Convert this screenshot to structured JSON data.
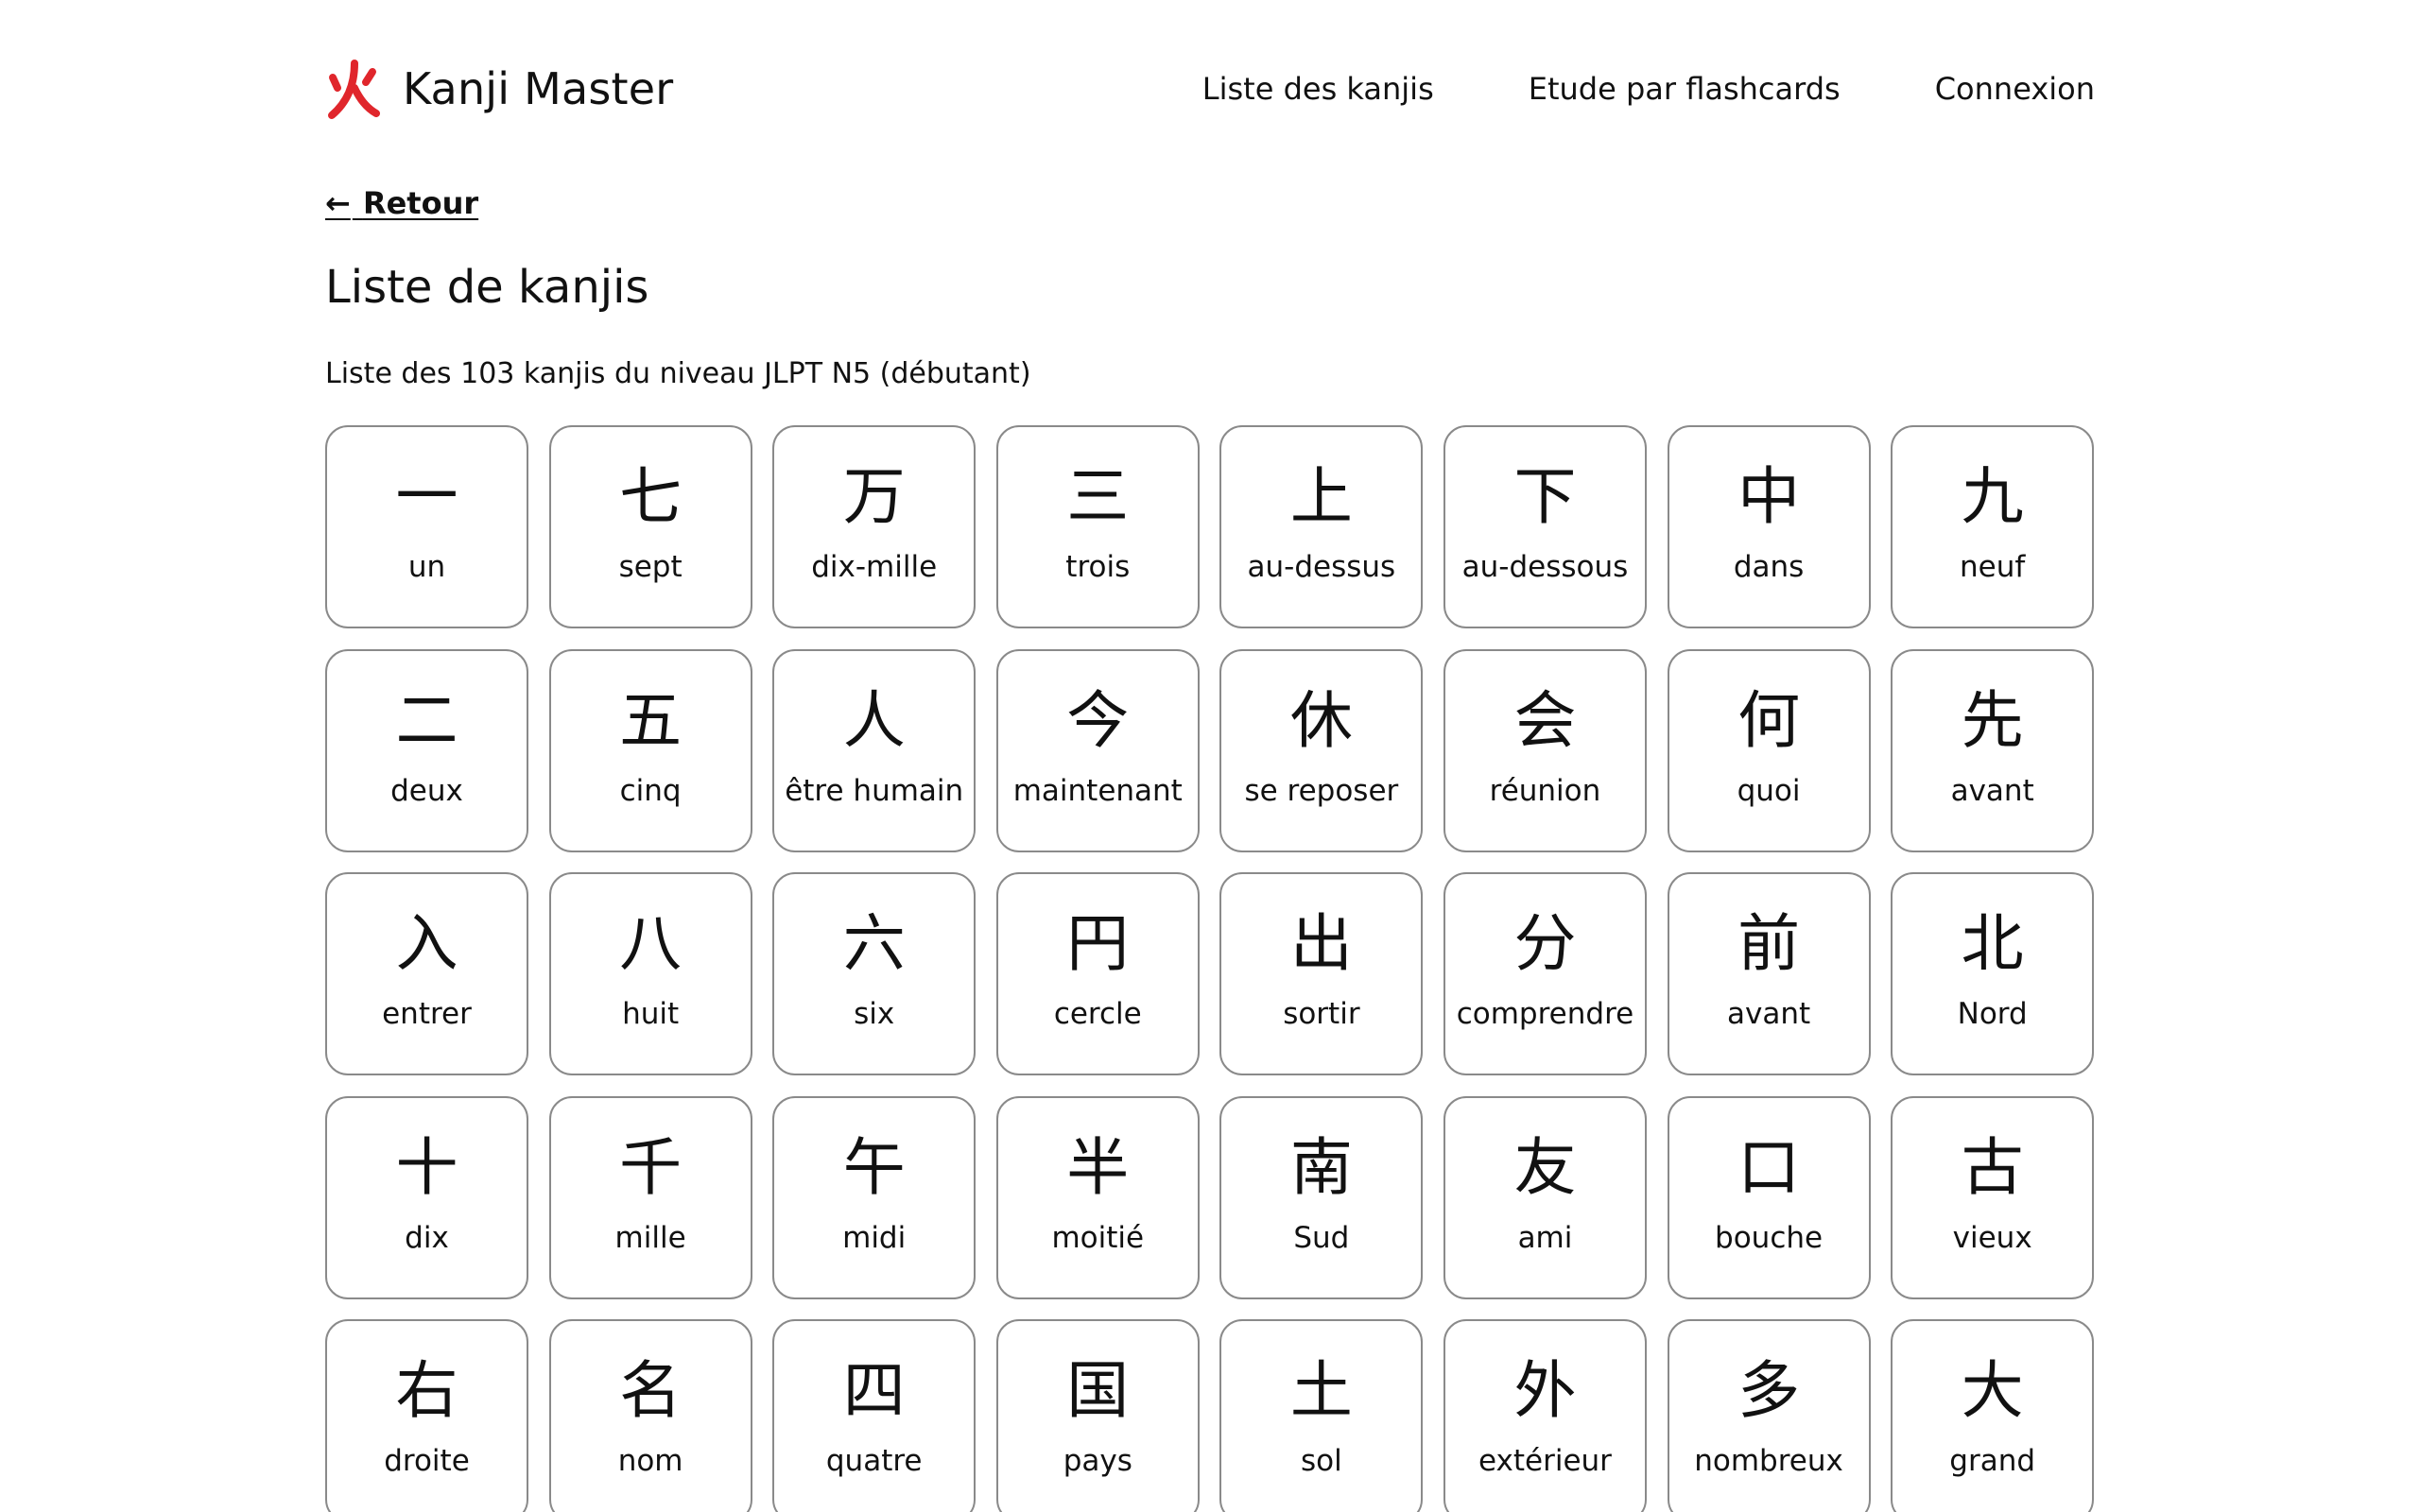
{
  "header": {
    "brand_name": "Kanji Master",
    "brand_color": "#e0262c",
    "logo_icon": "fire-kanji-logo",
    "nav": [
      {
        "label": "Liste des kanjis"
      },
      {
        "label": "Etude par flashcards"
      },
      {
        "label": "Connexion"
      }
    ]
  },
  "back_link": {
    "arrow": "←",
    "label": "Retour"
  },
  "page_title": "Liste de kanjis",
  "subtitle": "Liste des 103 kanjis du niveau JLPT N5 (débutant)",
  "kanjis": [
    {
      "kanji": "一",
      "meaning": "un"
    },
    {
      "kanji": "七",
      "meaning": "sept"
    },
    {
      "kanji": "万",
      "meaning": "dix-mille"
    },
    {
      "kanji": "三",
      "meaning": "trois"
    },
    {
      "kanji": "上",
      "meaning": "au-dessus"
    },
    {
      "kanji": "下",
      "meaning": "au-dessous"
    },
    {
      "kanji": "中",
      "meaning": "dans"
    },
    {
      "kanji": "九",
      "meaning": "neuf"
    },
    {
      "kanji": "二",
      "meaning": "deux"
    },
    {
      "kanji": "五",
      "meaning": "cinq"
    },
    {
      "kanji": "人",
      "meaning": "être humain"
    },
    {
      "kanji": "今",
      "meaning": "maintenant"
    },
    {
      "kanji": "休",
      "meaning": "se reposer"
    },
    {
      "kanji": "会",
      "meaning": "réunion"
    },
    {
      "kanji": "何",
      "meaning": "quoi"
    },
    {
      "kanji": "先",
      "meaning": "avant"
    },
    {
      "kanji": "入",
      "meaning": "entrer"
    },
    {
      "kanji": "八",
      "meaning": "huit"
    },
    {
      "kanji": "六",
      "meaning": "six"
    },
    {
      "kanji": "円",
      "meaning": "cercle"
    },
    {
      "kanji": "出",
      "meaning": "sortir"
    },
    {
      "kanji": "分",
      "meaning": "comprendre"
    },
    {
      "kanji": "前",
      "meaning": "avant"
    },
    {
      "kanji": "北",
      "meaning": "Nord"
    },
    {
      "kanji": "十",
      "meaning": "dix"
    },
    {
      "kanji": "千",
      "meaning": "mille"
    },
    {
      "kanji": "午",
      "meaning": "midi"
    },
    {
      "kanji": "半",
      "meaning": "moitié"
    },
    {
      "kanji": "南",
      "meaning": "Sud"
    },
    {
      "kanji": "友",
      "meaning": "ami"
    },
    {
      "kanji": "口",
      "meaning": "bouche"
    },
    {
      "kanji": "古",
      "meaning": "vieux"
    },
    {
      "kanji": "右",
      "meaning": "droite"
    },
    {
      "kanji": "名",
      "meaning": "nom"
    },
    {
      "kanji": "四",
      "meaning": "quatre"
    },
    {
      "kanji": "国",
      "meaning": "pays"
    },
    {
      "kanji": "土",
      "meaning": "sol"
    },
    {
      "kanji": "外",
      "meaning": "extérieur"
    },
    {
      "kanji": "多",
      "meaning": "nombreux"
    },
    {
      "kanji": "大",
      "meaning": "grand"
    }
  ]
}
